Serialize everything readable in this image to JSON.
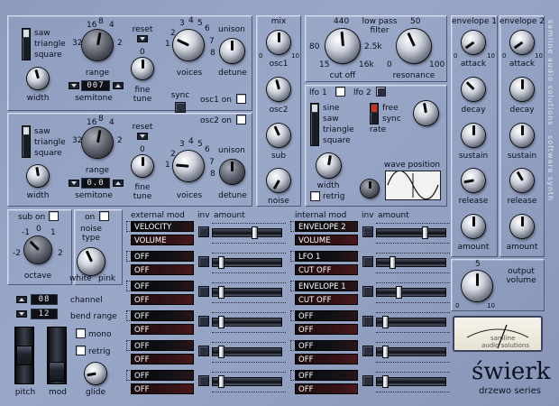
{
  "osc1": {
    "waveforms": [
      "saw",
      "triangle",
      "square"
    ],
    "width": "width",
    "range": "range",
    "range_ticks": [
      "16",
      "8",
      "4",
      "32",
      "2"
    ],
    "semitone": "semitone",
    "semitone_value": "007",
    "reset": "reset",
    "fine_tune": "fine\ntune",
    "voices": "voices",
    "voices_ticks": [
      "3",
      "4",
      "5",
      "6",
      "2",
      "7",
      "1",
      "8"
    ],
    "unison": "unison",
    "detune": "detune",
    "sync": "sync",
    "osc1_on": "osc1 on"
  },
  "osc2": {
    "waveforms": [
      "saw",
      "triangle",
      "square"
    ],
    "width": "width",
    "range": "range",
    "range_ticks": [
      "16",
      "8",
      "4",
      "32",
      "2"
    ],
    "semitone": "semitone",
    "semitone_value": "0.0",
    "reset": "reset",
    "fine_tune": "fine\ntune",
    "voices": "voices",
    "voices_ticks": [
      "3",
      "4",
      "5",
      "6",
      "2",
      "7",
      "1",
      "8"
    ],
    "unison": "unison",
    "detune": "detune",
    "osc2_on": "osc2 on"
  },
  "mix": {
    "title": "mix",
    "knobs": [
      "osc1",
      "osc2",
      "sub",
      "noise"
    ],
    "range_min": "0",
    "range_max": "10"
  },
  "filter": {
    "title_line1": "low pass",
    "title_line2": "filter",
    "cutoff": "cut off",
    "cutoff_ticks": [
      "440",
      "80",
      "2.5k",
      "15",
      "16k"
    ],
    "resonance": "resonance",
    "resonance_ticks": [
      "50",
      "0",
      "100"
    ]
  },
  "lfo": {
    "lfo1": "lfo 1",
    "lfo2": "lfo 2",
    "shapes": [
      "sine",
      "saw",
      "triangle",
      "square"
    ],
    "free": "free",
    "sync": "sync",
    "rate": "rate",
    "width": "width",
    "retrig": "retrig",
    "wave_position": "wave position"
  },
  "envelope1": {
    "title": "envelope 1",
    "knobs": [
      "attack",
      "decay",
      "sustain",
      "release",
      "amount"
    ],
    "range_min": "0",
    "range_max": "10"
  },
  "envelope2": {
    "title": "envelope 2",
    "knobs": [
      "attack",
      "decay",
      "sustain",
      "release",
      "amount"
    ],
    "range_min": "0",
    "range_max": "10"
  },
  "sub": {
    "sub_on": "sub on",
    "octave": "octave",
    "octave_ticks": [
      "-1",
      "0",
      "1",
      "-2",
      "2"
    ]
  },
  "noise": {
    "on": "on",
    "noise_type": "noise\ntype",
    "white": "white",
    "pink": "pink"
  },
  "external_mod": {
    "title": "external mod",
    "inv": "inv",
    "amount": "amount",
    "rows": [
      {
        "source": "VELOCITY",
        "target": "VOLUME",
        "amount": 0.62
      },
      {
        "source": "OFF",
        "target": "OFF",
        "amount": 0.08
      },
      {
        "source": "OFF",
        "target": "OFF",
        "amount": 0.08
      },
      {
        "source": "OFF",
        "target": "OFF",
        "amount": 0.08
      },
      {
        "source": "OFF",
        "target": "OFF",
        "amount": 0.08
      },
      {
        "source": "OFF",
        "target": "OFF",
        "amount": 0.08
      }
    ]
  },
  "internal_mod": {
    "title": "internal mod",
    "inv": "inv",
    "amount": "amount",
    "rows": [
      {
        "source": "ENVELOPE 2",
        "target": "VOLUME",
        "amount": 0.72
      },
      {
        "source": "LFO 1",
        "target": "CUT OFF",
        "amount": 0.2
      },
      {
        "source": "ENVELOPE 1",
        "target": "CUT OFF",
        "amount": 0.3
      },
      {
        "source": "OFF",
        "target": "OFF",
        "amount": 0.08
      },
      {
        "source": "OFF",
        "target": "OFF",
        "amount": 0.08
      },
      {
        "source": "OFF",
        "target": "OFF",
        "amount": 0.08
      }
    ]
  },
  "performance": {
    "channel": "channel",
    "channel_value": "08",
    "bend_range": "bend range",
    "bend_value": "12",
    "mono": "mono",
    "retrig": "retrig",
    "pitch": "pitch",
    "mod": "mod",
    "glide": "glide"
  },
  "output": {
    "label": "output\nvolume",
    "tick_min": "0",
    "tick_mid": "5",
    "tick_max": "10"
  },
  "meter_text": [
    "samline",
    "audio solutions"
  ],
  "side_text": "samline audio solutions · software synth",
  "brand": {
    "name": "świerk",
    "series": "drzewo series"
  },
  "colors": {
    "panel_bg": "#94a2c2",
    "accent_red": "#c8312a",
    "display_bg": "#0e1016"
  }
}
